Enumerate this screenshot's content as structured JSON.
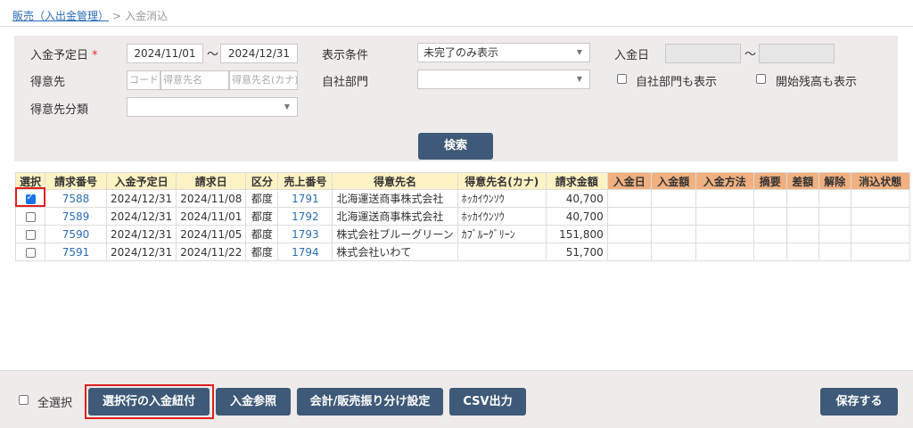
{
  "breadcrumb": {
    "parent": "販売（入出金管理）",
    "separator": ">",
    "current": "入金消込"
  },
  "filter": {
    "due_date_label": "入金予定日",
    "required_mark": "*",
    "due_from": "2024/11/01",
    "due_to": "2024/12/31",
    "tilde": "〜",
    "display_cond_label": "表示条件",
    "display_cond_value": "未完了のみ表示",
    "payment_date_label": "入金日",
    "customer_label": "得意先",
    "customer_code_ph": "コード",
    "customer_name_ph": "得意先名",
    "customer_kana_ph": "得意先名(カナ)",
    "dept_label": "自社部門",
    "dept_value": "",
    "show_dept_label": "自社部門も表示",
    "show_opening_label": "開始残高も表示",
    "customer_cat_label": "得意先分類",
    "customer_cat_value": "",
    "search_label": "検索"
  },
  "table": {
    "headers": [
      "選択",
      "請求番号",
      "入金予定日",
      "請求日",
      "区分",
      "売上番号",
      "得意先名",
      "得意先名(カナ)",
      "請求金額",
      "入金日",
      "入金額",
      "入金方法",
      "摘要",
      "差額",
      "解除",
      "消込状態"
    ],
    "rows": [
      {
        "checked": true,
        "invoice": "7588",
        "due": "2024/12/31",
        "bill_date": "2024/11/08",
        "type": "都度",
        "sales_no": "1791",
        "customer": "北海運送商事株式会社",
        "kana": "ﾎｯｶｲｳﾝｿｳ",
        "amount": "40,700"
      },
      {
        "checked": false,
        "invoice": "7589",
        "due": "2024/12/31",
        "bill_date": "2024/11/01",
        "type": "都度",
        "sales_no": "1792",
        "customer": "北海運送商事株式会社",
        "kana": "ﾎｯｶｲｳﾝｿｳ",
        "amount": "40,700"
      },
      {
        "checked": false,
        "invoice": "7590",
        "due": "2024/12/31",
        "bill_date": "2024/11/05",
        "type": "都度",
        "sales_no": "1793",
        "customer": "株式会社ブルーグリーン",
        "kana": "ｶﾌﾞﾙｰｸﾞﾘｰﾝ",
        "amount": "151,800"
      },
      {
        "checked": false,
        "invoice": "7591",
        "due": "2024/12/31",
        "bill_date": "2024/11/22",
        "type": "都度",
        "sales_no": "1794",
        "customer": "株式会社いわて",
        "kana": "",
        "amount": "51,700"
      }
    ]
  },
  "footer": {
    "select_all_label": "全選択",
    "link_selected": "選択行の入金紐付",
    "payment_ref": "入金参照",
    "accounting_setting": "会計/販売振り分け設定",
    "csv_export": "CSV出力",
    "save": "保存する"
  },
  "colors": {
    "button": "#3f5a78",
    "header_bg": "#fdf2c4",
    "header_orange": "#f0b080",
    "link": "#2a6db5",
    "highlight": "#e02020"
  }
}
